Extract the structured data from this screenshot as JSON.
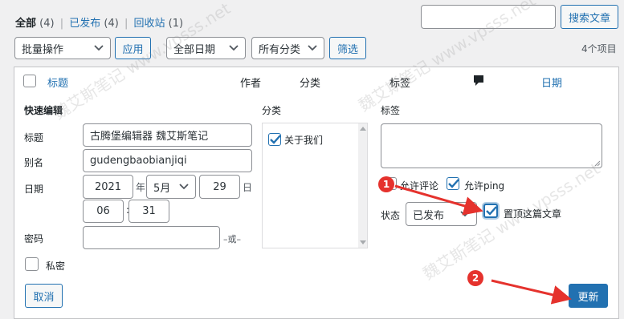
{
  "filters": {
    "all_label": "全部",
    "all_count": "(4)",
    "sep1": "|",
    "published_label": "已发布",
    "published_count": "(4)",
    "sep2": "|",
    "trash_label": "回收站",
    "trash_count": "(1)"
  },
  "search": {
    "value": "",
    "button_label": "搜索文章"
  },
  "bulk": {
    "bulk_select": "批量操作",
    "apply_label": "应用",
    "date_select": "全部日期",
    "category_select": "所有分类",
    "filter_label": "筛选",
    "item_count": "4个项目"
  },
  "table": {
    "col_title": "标题",
    "col_author": "作者",
    "col_category": "分类",
    "col_tags": "标签",
    "col_comments_icon": "comment-icon",
    "col_date": "日期"
  },
  "quick_edit": {
    "heading": "快速编辑",
    "title_label": "标题",
    "title_value": "古腾堡编辑器 魏艾斯笔记",
    "slug_label": "别名",
    "slug_value": "gudengbaobianjiqi",
    "date_label": "日期",
    "year": "2021",
    "year_suffix": "年",
    "month": "5月",
    "day": "29",
    "day_suffix": "日",
    "hour": "06",
    "time_sep": ":",
    "minute": "31",
    "password_label": "密码",
    "password_value": "",
    "or_label": "–或–",
    "private_label": "私密",
    "categories_heading": "分类",
    "category_item": "关于我们",
    "tags_heading": "标签",
    "tags_value": "",
    "allow_comments_label": "允许评论",
    "allow_ping_label": "允许ping",
    "status_label": "状态",
    "status_value": "已发布",
    "sticky_label": "置顶这篇文章",
    "cancel_label": "取消",
    "update_label": "更新"
  },
  "annotations": {
    "badge1": "1",
    "badge2": "2",
    "color": "#e5322d"
  },
  "colors": {
    "accent": "#2271b1",
    "background": "#f0f0f1"
  }
}
